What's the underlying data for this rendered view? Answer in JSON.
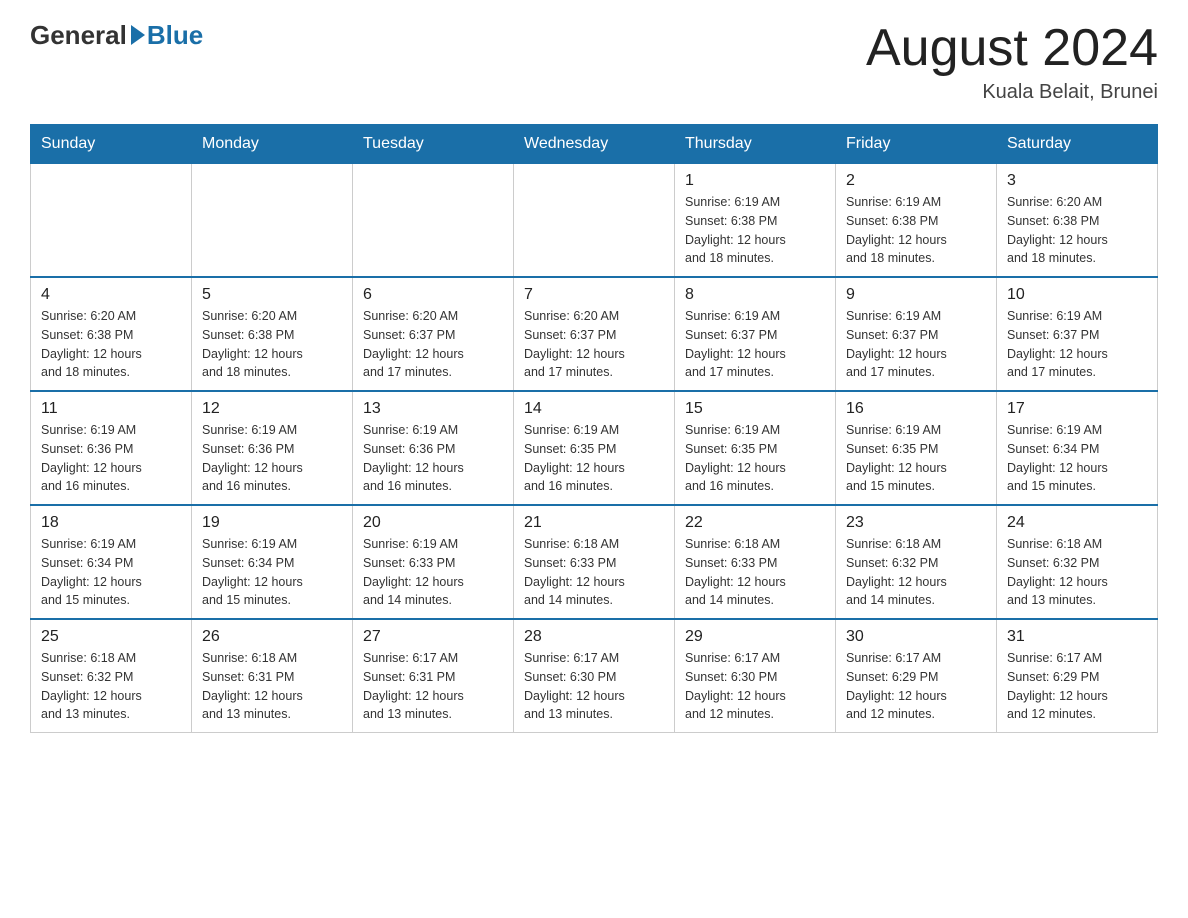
{
  "header": {
    "logo_general": "General",
    "logo_blue": "Blue",
    "month_year": "August 2024",
    "location": "Kuala Belait, Brunei"
  },
  "days_of_week": [
    "Sunday",
    "Monday",
    "Tuesday",
    "Wednesday",
    "Thursday",
    "Friday",
    "Saturday"
  ],
  "weeks": [
    {
      "days": [
        {
          "number": "",
          "info": ""
        },
        {
          "number": "",
          "info": ""
        },
        {
          "number": "",
          "info": ""
        },
        {
          "number": "",
          "info": ""
        },
        {
          "number": "1",
          "info": "Sunrise: 6:19 AM\nSunset: 6:38 PM\nDaylight: 12 hours\nand 18 minutes."
        },
        {
          "number": "2",
          "info": "Sunrise: 6:19 AM\nSunset: 6:38 PM\nDaylight: 12 hours\nand 18 minutes."
        },
        {
          "number": "3",
          "info": "Sunrise: 6:20 AM\nSunset: 6:38 PM\nDaylight: 12 hours\nand 18 minutes."
        }
      ]
    },
    {
      "days": [
        {
          "number": "4",
          "info": "Sunrise: 6:20 AM\nSunset: 6:38 PM\nDaylight: 12 hours\nand 18 minutes."
        },
        {
          "number": "5",
          "info": "Sunrise: 6:20 AM\nSunset: 6:38 PM\nDaylight: 12 hours\nand 18 minutes."
        },
        {
          "number": "6",
          "info": "Sunrise: 6:20 AM\nSunset: 6:37 PM\nDaylight: 12 hours\nand 17 minutes."
        },
        {
          "number": "7",
          "info": "Sunrise: 6:20 AM\nSunset: 6:37 PM\nDaylight: 12 hours\nand 17 minutes."
        },
        {
          "number": "8",
          "info": "Sunrise: 6:19 AM\nSunset: 6:37 PM\nDaylight: 12 hours\nand 17 minutes."
        },
        {
          "number": "9",
          "info": "Sunrise: 6:19 AM\nSunset: 6:37 PM\nDaylight: 12 hours\nand 17 minutes."
        },
        {
          "number": "10",
          "info": "Sunrise: 6:19 AM\nSunset: 6:37 PM\nDaylight: 12 hours\nand 17 minutes."
        }
      ]
    },
    {
      "days": [
        {
          "number": "11",
          "info": "Sunrise: 6:19 AM\nSunset: 6:36 PM\nDaylight: 12 hours\nand 16 minutes."
        },
        {
          "number": "12",
          "info": "Sunrise: 6:19 AM\nSunset: 6:36 PM\nDaylight: 12 hours\nand 16 minutes."
        },
        {
          "number": "13",
          "info": "Sunrise: 6:19 AM\nSunset: 6:36 PM\nDaylight: 12 hours\nand 16 minutes."
        },
        {
          "number": "14",
          "info": "Sunrise: 6:19 AM\nSunset: 6:35 PM\nDaylight: 12 hours\nand 16 minutes."
        },
        {
          "number": "15",
          "info": "Sunrise: 6:19 AM\nSunset: 6:35 PM\nDaylight: 12 hours\nand 16 minutes."
        },
        {
          "number": "16",
          "info": "Sunrise: 6:19 AM\nSunset: 6:35 PM\nDaylight: 12 hours\nand 15 minutes."
        },
        {
          "number": "17",
          "info": "Sunrise: 6:19 AM\nSunset: 6:34 PM\nDaylight: 12 hours\nand 15 minutes."
        }
      ]
    },
    {
      "days": [
        {
          "number": "18",
          "info": "Sunrise: 6:19 AM\nSunset: 6:34 PM\nDaylight: 12 hours\nand 15 minutes."
        },
        {
          "number": "19",
          "info": "Sunrise: 6:19 AM\nSunset: 6:34 PM\nDaylight: 12 hours\nand 15 minutes."
        },
        {
          "number": "20",
          "info": "Sunrise: 6:19 AM\nSunset: 6:33 PM\nDaylight: 12 hours\nand 14 minutes."
        },
        {
          "number": "21",
          "info": "Sunrise: 6:18 AM\nSunset: 6:33 PM\nDaylight: 12 hours\nand 14 minutes."
        },
        {
          "number": "22",
          "info": "Sunrise: 6:18 AM\nSunset: 6:33 PM\nDaylight: 12 hours\nand 14 minutes."
        },
        {
          "number": "23",
          "info": "Sunrise: 6:18 AM\nSunset: 6:32 PM\nDaylight: 12 hours\nand 14 minutes."
        },
        {
          "number": "24",
          "info": "Sunrise: 6:18 AM\nSunset: 6:32 PM\nDaylight: 12 hours\nand 13 minutes."
        }
      ]
    },
    {
      "days": [
        {
          "number": "25",
          "info": "Sunrise: 6:18 AM\nSunset: 6:32 PM\nDaylight: 12 hours\nand 13 minutes."
        },
        {
          "number": "26",
          "info": "Sunrise: 6:18 AM\nSunset: 6:31 PM\nDaylight: 12 hours\nand 13 minutes."
        },
        {
          "number": "27",
          "info": "Sunrise: 6:17 AM\nSunset: 6:31 PM\nDaylight: 12 hours\nand 13 minutes."
        },
        {
          "number": "28",
          "info": "Sunrise: 6:17 AM\nSunset: 6:30 PM\nDaylight: 12 hours\nand 13 minutes."
        },
        {
          "number": "29",
          "info": "Sunrise: 6:17 AM\nSunset: 6:30 PM\nDaylight: 12 hours\nand 12 minutes."
        },
        {
          "number": "30",
          "info": "Sunrise: 6:17 AM\nSunset: 6:29 PM\nDaylight: 12 hours\nand 12 minutes."
        },
        {
          "number": "31",
          "info": "Sunrise: 6:17 AM\nSunset: 6:29 PM\nDaylight: 12 hours\nand 12 minutes."
        }
      ]
    }
  ]
}
